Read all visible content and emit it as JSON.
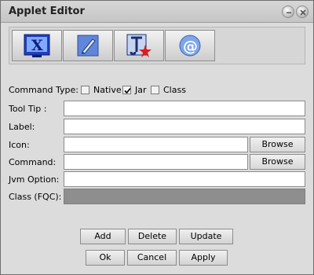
{
  "window": {
    "title": "Applet Editor"
  },
  "toolbar": {
    "buttons": [
      {
        "icon": "x-window-icon"
      },
      {
        "icon": "pencil-icon"
      },
      {
        "icon": "java-icon"
      },
      {
        "icon": "at-sign-icon"
      }
    ]
  },
  "command_type": {
    "label": "Command Type:",
    "options": [
      {
        "label": "Native",
        "checked": false
      },
      {
        "label": "Jar",
        "checked": true
      },
      {
        "label": "Class",
        "checked": false
      }
    ]
  },
  "form": {
    "tooltip_label": "Tool Tip :",
    "tooltip_value": "",
    "label_label": "Label:",
    "label_value": "",
    "icon_label": "Icon:",
    "icon_value": "",
    "command_label": "Command:",
    "command_value": "",
    "jvm_label": "Jvm Option:",
    "jvm_value": "",
    "class_label": "Class (FQC):",
    "class_value": "",
    "browse_label": "Browse"
  },
  "actions": {
    "add": "Add",
    "delete": "Delete",
    "update": "Update",
    "ok": "Ok",
    "cancel": "Cancel",
    "apply": "Apply"
  }
}
